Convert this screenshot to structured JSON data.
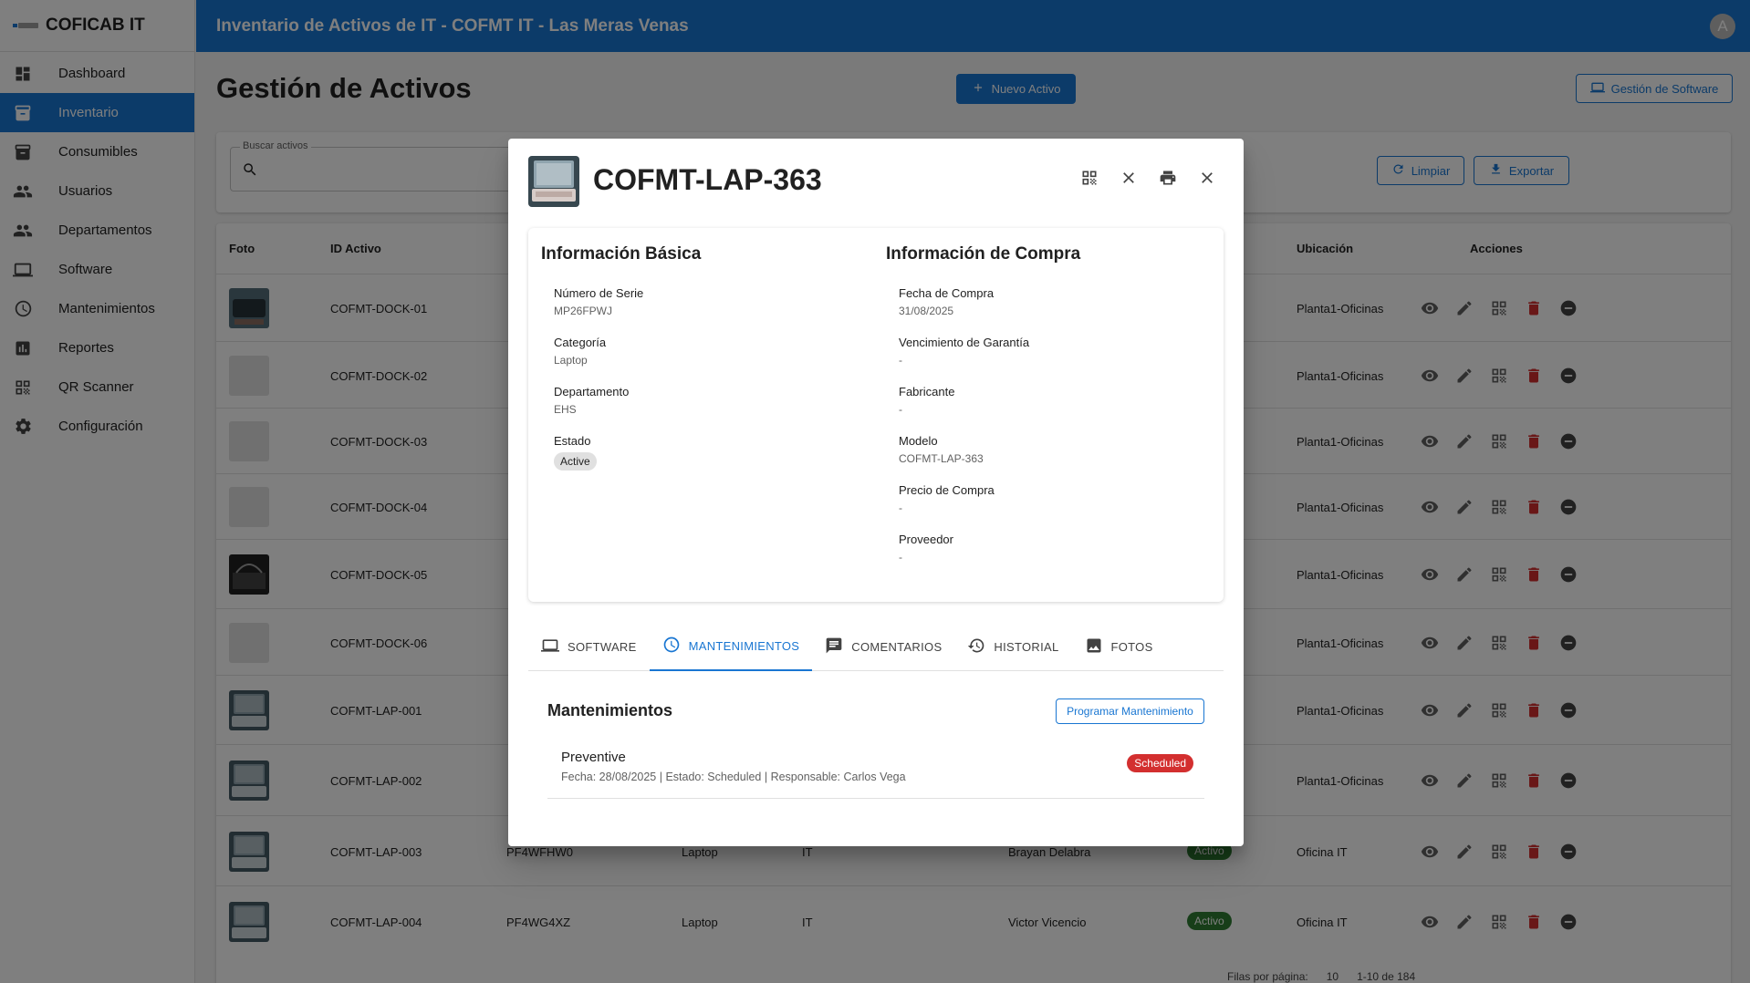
{
  "app": {
    "brand": "COFICAB IT",
    "title": "Inventario de Activos de IT - COFMT IT - Las Meras Venas",
    "avatar_initial": "A"
  },
  "sidebar": {
    "items": [
      {
        "label": "Dashboard",
        "icon": "dashboard-icon"
      },
      {
        "label": "Inventario",
        "icon": "inventory-icon",
        "active": true
      },
      {
        "label": "Consumibles",
        "icon": "archive-icon"
      },
      {
        "label": "Usuarios",
        "icon": "people-icon"
      },
      {
        "label": "Departamentos",
        "icon": "group-icon"
      },
      {
        "label": "Software",
        "icon": "laptop-icon"
      },
      {
        "label": "Mantenimientos",
        "icon": "clock-icon"
      },
      {
        "label": "Reportes",
        "icon": "bar-chart-icon"
      },
      {
        "label": "QR Scanner",
        "icon": "qr-icon"
      },
      {
        "label": "Configuración",
        "icon": "gear-icon"
      }
    ]
  },
  "main": {
    "title": "Gestión de Activos",
    "new_asset_button": "Nuevo Activo",
    "software_button": "Gestión de Software",
    "search_label": "Buscar activos",
    "search_value": "",
    "clear_button": "Limpiar",
    "export_button": "Exportar"
  },
  "table": {
    "headers": {
      "foto": "Foto",
      "id": "ID Activo",
      "ubicacion": "Ubicación",
      "acciones": "Acciones"
    },
    "rows": [
      {
        "id": "COFMT-DOCK-01",
        "serial": "",
        "category": "",
        "dept": "",
        "user": "",
        "status": "",
        "location": "Planta1-Oficinas",
        "photo": "dock"
      },
      {
        "id": "COFMT-DOCK-02",
        "serial": "",
        "category": "",
        "dept": "",
        "user": "",
        "status": "",
        "location": "Planta1-Oficinas",
        "photo": "none"
      },
      {
        "id": "COFMT-DOCK-03",
        "serial": "",
        "category": "",
        "dept": "",
        "user": "",
        "status": "",
        "location": "Planta1-Oficinas",
        "photo": "none"
      },
      {
        "id": "COFMT-DOCK-04",
        "serial": "",
        "category": "",
        "dept": "",
        "user": "",
        "status": "",
        "location": "Planta1-Oficinas",
        "photo": "none"
      },
      {
        "id": "COFMT-DOCK-05",
        "serial": "",
        "category": "",
        "dept": "",
        "user": "",
        "status": "",
        "location": "Planta1-Oficinas",
        "photo": "cable"
      },
      {
        "id": "COFMT-DOCK-06",
        "serial": "",
        "category": "",
        "dept": "",
        "user": "",
        "status": "",
        "location": "Planta1-Oficinas",
        "photo": "none"
      },
      {
        "id": "COFMT-LAP-001",
        "serial": "",
        "category": "",
        "dept": "",
        "user": "",
        "status": "",
        "location": "Planta1-Oficinas",
        "photo": "laptop"
      },
      {
        "id": "COFMT-LAP-002",
        "serial": "",
        "category": "",
        "dept": "",
        "user": "",
        "status": "",
        "location": "Planta1-Oficinas",
        "photo": "laptop"
      },
      {
        "id": "COFMT-LAP-003",
        "serial": "PF4WFHW0",
        "category": "Laptop",
        "dept": "IT",
        "user": "Brayan Delabra",
        "status": "Activo",
        "location": "Oficina IT",
        "photo": "laptop"
      },
      {
        "id": "COFMT-LAP-004",
        "serial": "PF4WG4XZ",
        "category": "Laptop",
        "dept": "IT",
        "user": "Victor Vicencio",
        "status": "Activo",
        "location": "Oficina IT",
        "photo": "laptop"
      }
    ],
    "status_color": "#2e7d32"
  },
  "pagination": {
    "rows_per_page_label": "Filas por página:",
    "rows_per_page": "10",
    "range": "1-10 de 184"
  },
  "modal": {
    "title": "COFMT-LAP-363",
    "basic": {
      "title": "Información Básica",
      "fields": [
        {
          "label": "Número de Serie",
          "value": "MP26FPWJ"
        },
        {
          "label": "Categoría",
          "value": "Laptop"
        },
        {
          "label": "Departamento",
          "value": "EHS"
        },
        {
          "label": "Estado",
          "value": "Active"
        }
      ]
    },
    "purchase": {
      "title": "Información de Compra",
      "fields": [
        {
          "label": "Fecha de Compra",
          "value": "31/08/2025"
        },
        {
          "label": "Vencimiento de Garantía",
          "value": "-"
        },
        {
          "label": "Fabricante",
          "value": "-"
        },
        {
          "label": "Modelo",
          "value": "COFMT-LAP-363"
        },
        {
          "label": "Precio de Compra",
          "value": "-"
        },
        {
          "label": "Proveedor",
          "value": "-"
        }
      ]
    },
    "tabs": [
      {
        "label": "SOFTWARE",
        "icon": "laptop-icon"
      },
      {
        "label": "MANTENIMIENTOS",
        "icon": "clock-icon",
        "active": true
      },
      {
        "label": "COMENTARIOS",
        "icon": "comment-icon"
      },
      {
        "label": "HISTORIAL",
        "icon": "history-icon"
      },
      {
        "label": "FOTOS",
        "icon": "image-icon"
      }
    ],
    "maintenance": {
      "title": "Mantenimientos",
      "schedule_button": "Programar Mantenimiento",
      "items": [
        {
          "type": "Preventive",
          "detail": "Fecha: 28/08/2025 | Estado: Scheduled | Responsable: Carlos Vega",
          "status": "Scheduled"
        }
      ]
    }
  },
  "colors": {
    "primary": "#1976d2",
    "danger": "#d32f2f",
    "success": "#2e7d32"
  }
}
